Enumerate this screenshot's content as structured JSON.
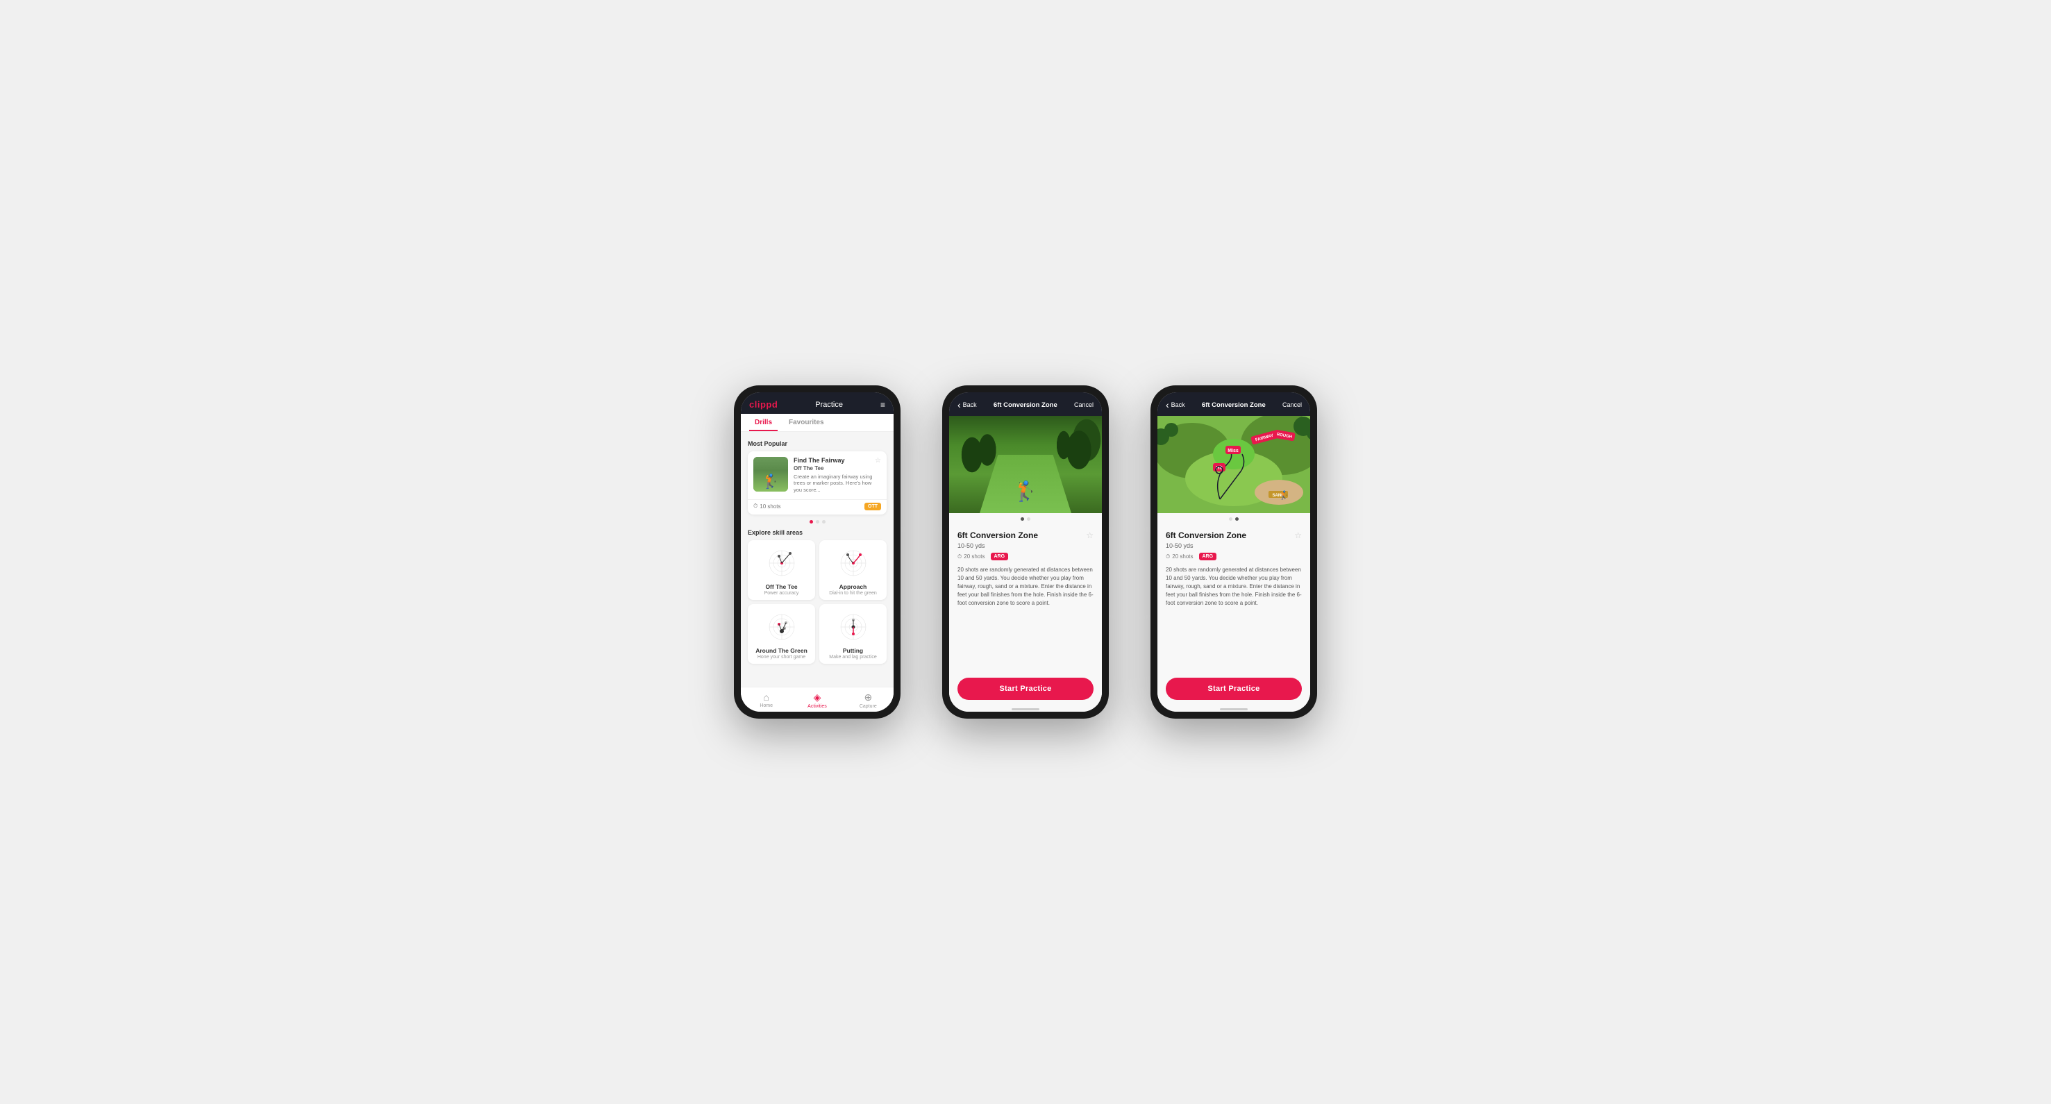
{
  "phones": [
    {
      "id": "drills-list",
      "header": {
        "logo": "clippd",
        "nav_title": "Practice",
        "menu_icon": "≡"
      },
      "tabs": [
        "Drills",
        "Favourites"
      ],
      "active_tab": "Drills",
      "sections": {
        "most_popular": "Most Popular",
        "explore": "Explore skill areas"
      },
      "featured_card": {
        "title": "Find The Fairway",
        "subtitle": "Off The Tee",
        "description": "Create an imaginary fairway using trees or marker posts. Here's how you score...",
        "shots": "10 shots",
        "badge": "OTT",
        "fav": "☆"
      },
      "skill_areas": [
        {
          "name": "Off The Tee",
          "sub": "Power accuracy"
        },
        {
          "name": "Approach",
          "sub": "Dial-in to hit the green"
        },
        {
          "name": "Around The Green",
          "sub": "Hone your short game"
        },
        {
          "name": "Putting",
          "sub": "Make and lag practice"
        }
      ],
      "bottom_nav": [
        {
          "label": "Home",
          "icon": "⌂",
          "active": false
        },
        {
          "label": "Activities",
          "icon": "♦",
          "active": true
        },
        {
          "label": "Capture",
          "icon": "⊕",
          "active": false
        }
      ]
    },
    {
      "id": "detail-photo",
      "header": {
        "back": "Back",
        "title": "6ft Conversion Zone",
        "cancel": "Cancel"
      },
      "drill": {
        "title": "6ft Conversion Zone",
        "range": "10-50 yds",
        "shots": "20 shots",
        "badge": "ARG",
        "fav": "☆",
        "description": "20 shots are randomly generated at distances between 10 and 50 yards. You decide whether you play from fairway, rough, sand or a mixture. Enter the distance in feet your ball finishes from the hole. Finish inside the 6-foot conversion zone to score a point."
      },
      "start_button": "Start Practice"
    },
    {
      "id": "detail-illustration",
      "header": {
        "back": "Back",
        "title": "6ft Conversion Zone",
        "cancel": "Cancel"
      },
      "drill": {
        "title": "6ft Conversion Zone",
        "range": "10-50 yds",
        "shots": "20 shots",
        "badge": "ARG",
        "fav": "☆",
        "description": "20 shots are randomly generated at distances between 10 and 50 yards. You decide whether you play from fairway, rough, sand or a mixture. Enter the distance in feet your ball finishes from the hole. Finish inside the 6-foot conversion zone to score a point."
      },
      "start_button": "Start Practice"
    }
  ]
}
